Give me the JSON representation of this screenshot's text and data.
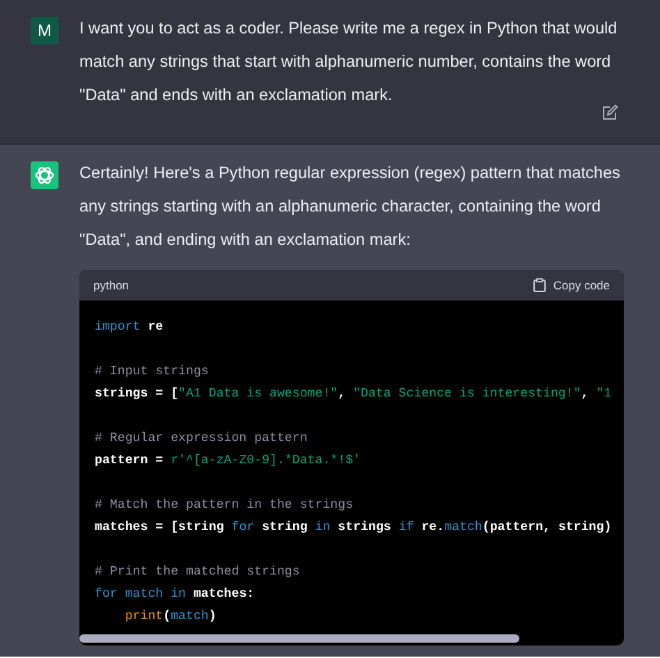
{
  "messages": [
    {
      "kind": "user",
      "avatar": "M",
      "text": "I want you to act as a coder. Please write me a regex in Python that would match any strings that start with alphanumeric number, contains the word \"Data\" and ends with an exclamation mark."
    },
    {
      "kind": "assistant",
      "text": "Certainly! Here's a Python regular expression (regex) pattern that matches any strings starting with an alphanumeric character, containing the word \"Data\", and ending with an exclamation mark:",
      "code_block": {
        "language": "python",
        "copy_label": "Copy code",
        "sections": [
          {
            "lines": [
              {
                "tokens": [
                  {
                    "kind": "keyword",
                    "text": "import"
                  },
                  {
                    "kind": "plain",
                    "text": " re"
                  }
                ]
              }
            ]
          },
          {
            "lines": [
              {
                "tokens": [
                  {
                    "kind": "comment",
                    "text": "# Input strings"
                  }
                ]
              },
              {
                "tokens": [
                  {
                    "kind": "plain",
                    "text": "strings = ["
                  },
                  {
                    "kind": "string",
                    "text": "\"A1 Data is awesome!\""
                  },
                  {
                    "kind": "plain",
                    "text": ", "
                  },
                  {
                    "kind": "string",
                    "text": "\"Data Science is interesting!\""
                  },
                  {
                    "kind": "plain",
                    "text": ", "
                  },
                  {
                    "kind": "string",
                    "text": "\"1"
                  }
                ]
              }
            ]
          },
          {
            "lines": [
              {
                "tokens": [
                  {
                    "kind": "comment",
                    "text": "# Regular expression pattern"
                  }
                ]
              },
              {
                "tokens": [
                  {
                    "kind": "plain",
                    "text": "pattern = "
                  },
                  {
                    "kind": "string",
                    "text": "r'^[a-zA-Z0-9].*Data.*!$'"
                  }
                ]
              }
            ]
          },
          {
            "lines": [
              {
                "tokens": [
                  {
                    "kind": "comment",
                    "text": "# Match the pattern in the strings"
                  }
                ]
              },
              {
                "tokens": [
                  {
                    "kind": "plain",
                    "text": "matches = [string "
                  },
                  {
                    "kind": "keyword",
                    "text": "for"
                  },
                  {
                    "kind": "plain",
                    "text": " string "
                  },
                  {
                    "kind": "keyword",
                    "text": "in"
                  },
                  {
                    "kind": "plain",
                    "text": " strings "
                  },
                  {
                    "kind": "keyword",
                    "text": "if"
                  },
                  {
                    "kind": "plain",
                    "text": " re."
                  },
                  {
                    "kind": "keyword",
                    "text": "match"
                  },
                  {
                    "kind": "plain",
                    "text": "(pattern, string)"
                  }
                ]
              }
            ]
          },
          {
            "lines": [
              {
                "tokens": [
                  {
                    "kind": "comment",
                    "text": "# Print the matched strings"
                  }
                ]
              },
              {
                "tokens": [
                  {
                    "kind": "keyword",
                    "text": "for"
                  },
                  {
                    "kind": "keyword",
                    "text": " match"
                  },
                  {
                    "kind": "keyword",
                    "text": " in"
                  },
                  {
                    "kind": "plain",
                    "text": " matches:"
                  }
                ]
              },
              {
                "indented": true,
                "tokens": [
                  {
                    "kind": "builtin",
                    "text": "print"
                  },
                  {
                    "kind": "plain",
                    "text": "("
                  },
                  {
                    "kind": "keyword",
                    "text": "match"
                  },
                  {
                    "kind": "plain",
                    "text": ")"
                  }
                ]
              }
            ]
          }
        ]
      }
    }
  ]
}
